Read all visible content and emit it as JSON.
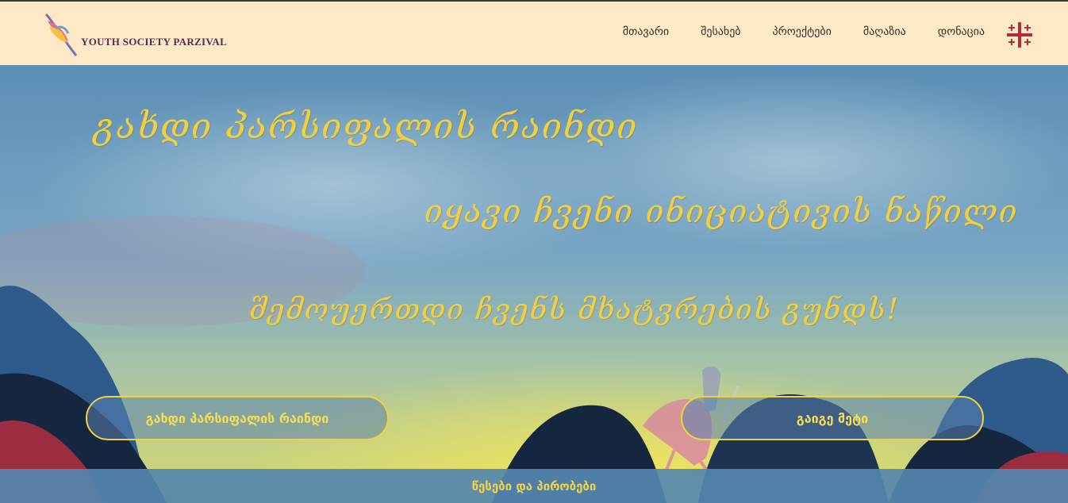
{
  "header": {
    "logo_text": "YOUTH SOCIETY PARZIVAL",
    "nav": [
      {
        "label": "მთავარი"
      },
      {
        "label": "შესახებ"
      },
      {
        "label": "პროექტები"
      },
      {
        "label": "მაღაზია"
      },
      {
        "label": "დონაცია"
      }
    ],
    "language_icon": "georgian-flag-icon"
  },
  "hero": {
    "headline_1": "გახდი პარსიფალის რაინდი",
    "headline_2": "იყავი ჩვენი ინიციატივის ნაწილი",
    "headline_3": "შემოუერთდი ჩვენს მხატვრების გუნდს!",
    "button_join": "გახდი პარსიფალის რაინდი",
    "button_more": "გაიგე მეტი"
  },
  "footer": {
    "terms_link": "წესები და პირობები"
  },
  "colors": {
    "header_bg": "#fde9c6",
    "accent_yellow": "#f3cf3c",
    "sky_blue": "#4a7fa6",
    "flag_red": "#b32b3b"
  }
}
